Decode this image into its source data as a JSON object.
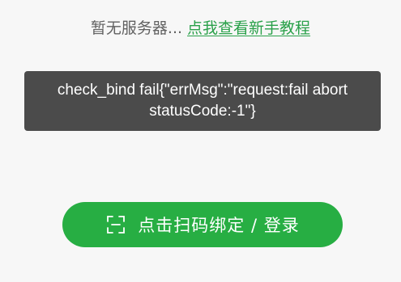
{
  "status": {
    "text": "暂无服务器...",
    "link_label": "点我查看新手教程"
  },
  "toast": {
    "message": "check_bind fail{\"errMsg\":\"request:fail abort statusCode:-1\"}"
  },
  "scan_button": {
    "icon": "scan-icon",
    "label": "点击扫码绑定 / 登录"
  },
  "colors": {
    "background": "#f7f7f7",
    "accent": "#27ae43",
    "link": "#2aa14a",
    "toast_bg": "#4b4b4b",
    "muted_text": "#616161"
  }
}
